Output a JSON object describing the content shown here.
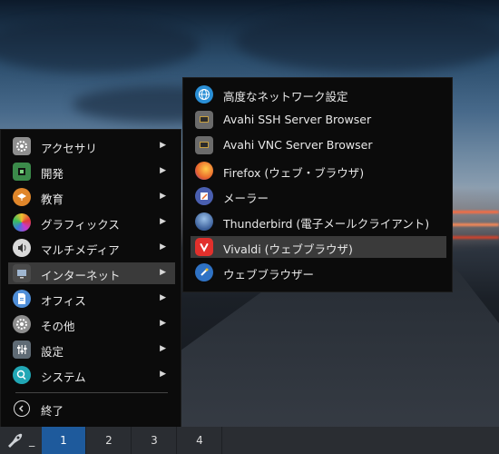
{
  "menu": {
    "items": [
      {
        "label": "アクセサリ",
        "icon": "gear-icon",
        "color": "#8e8e8e"
      },
      {
        "label": "開発",
        "icon": "development-icon",
        "color": "#3b8a4a"
      },
      {
        "label": "教育",
        "icon": "education-icon",
        "color": "#e0862a"
      },
      {
        "label": "グラフィックス",
        "icon": "graphics-icon",
        "color": "#d33a86"
      },
      {
        "label": "マルチメディア",
        "icon": "multimedia-icon",
        "color": "#d9d9d9"
      },
      {
        "label": "インターネット",
        "icon": "internet-icon",
        "color": "#4a4a4a"
      },
      {
        "label": "オフィス",
        "icon": "office-icon",
        "color": "#4f8ed8"
      },
      {
        "label": "その他",
        "icon": "other-gear-icon",
        "color": "#8e8e8e"
      },
      {
        "label": "設定",
        "icon": "settings-icon",
        "color": "#5f6b75"
      },
      {
        "label": "システム",
        "icon": "system-icon",
        "color": "#21a7b5"
      }
    ],
    "logout": {
      "label": "終了",
      "icon": "logout-icon"
    },
    "active_index": 5,
    "arrow": "▶"
  },
  "submenu": {
    "items": [
      {
        "label": "高度なネットワーク設定",
        "icon": "network-settings-icon",
        "color": "#2a8fd6"
      },
      {
        "label": "Avahi SSH Server Browser",
        "icon": "avahi-ssh-icon",
        "color": "#6b6b6b"
      },
      {
        "label": "Avahi VNC Server Browser",
        "icon": "avahi-vnc-icon",
        "color": "#6b6b6b"
      },
      {
        "label": "Firefox (ウェブ・ブラウザ)",
        "icon": "firefox-icon",
        "color": "#e8642b"
      },
      {
        "label": "メーラー",
        "icon": "mailer-icon",
        "color": "#4a5fb0"
      },
      {
        "label": "Thunderbird (電子メールクライアント)",
        "icon": "thunderbird-icon",
        "color": "#3b5f9a"
      },
      {
        "label": "Vivaldi (ウェブブラウザ)",
        "icon": "vivaldi-icon",
        "color": "#e2302c"
      },
      {
        "label": "ウェブブラウザー",
        "icon": "web-browser-icon",
        "color": "#2f72c4"
      }
    ],
    "active_index": 6
  },
  "taskbar": {
    "launcher_icon": "rocket-icon",
    "underscore": "_",
    "workspaces": [
      "1",
      "2",
      "3",
      "4"
    ],
    "active_workspace": 0,
    "active_color": "#1e5a9c"
  }
}
